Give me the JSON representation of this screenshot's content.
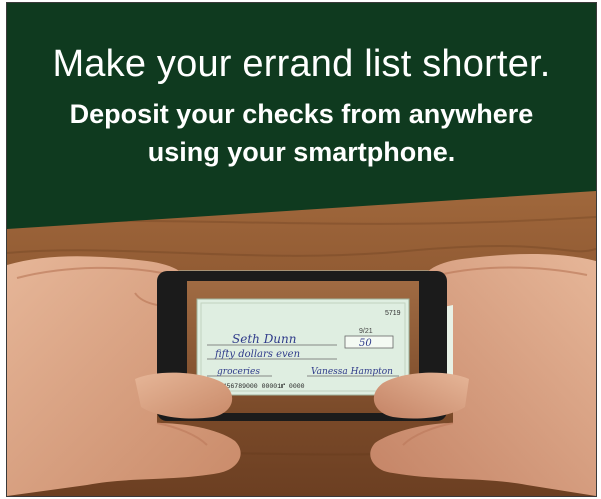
{
  "ad": {
    "headline": "Make your errand list shorter.",
    "subhead_line1": "Deposit your checks from anywhere",
    "subhead_line2": "using your smartphone.",
    "colors": {
      "banner": "#0f3a1f",
      "wood": "#8a5a34",
      "check": "#dfeee1",
      "phone": "#1b1b1b",
      "skin": "#d9a584"
    }
  },
  "check": {
    "number": "5719",
    "payee": "Seth Dunn",
    "amount_words": "fifty dollars even",
    "amount": "50",
    "date": "9/21",
    "memo": "groceries",
    "micr": "⑆000456789000 00001⑈ 0000",
    "signature": "Vanessa Hampton"
  }
}
